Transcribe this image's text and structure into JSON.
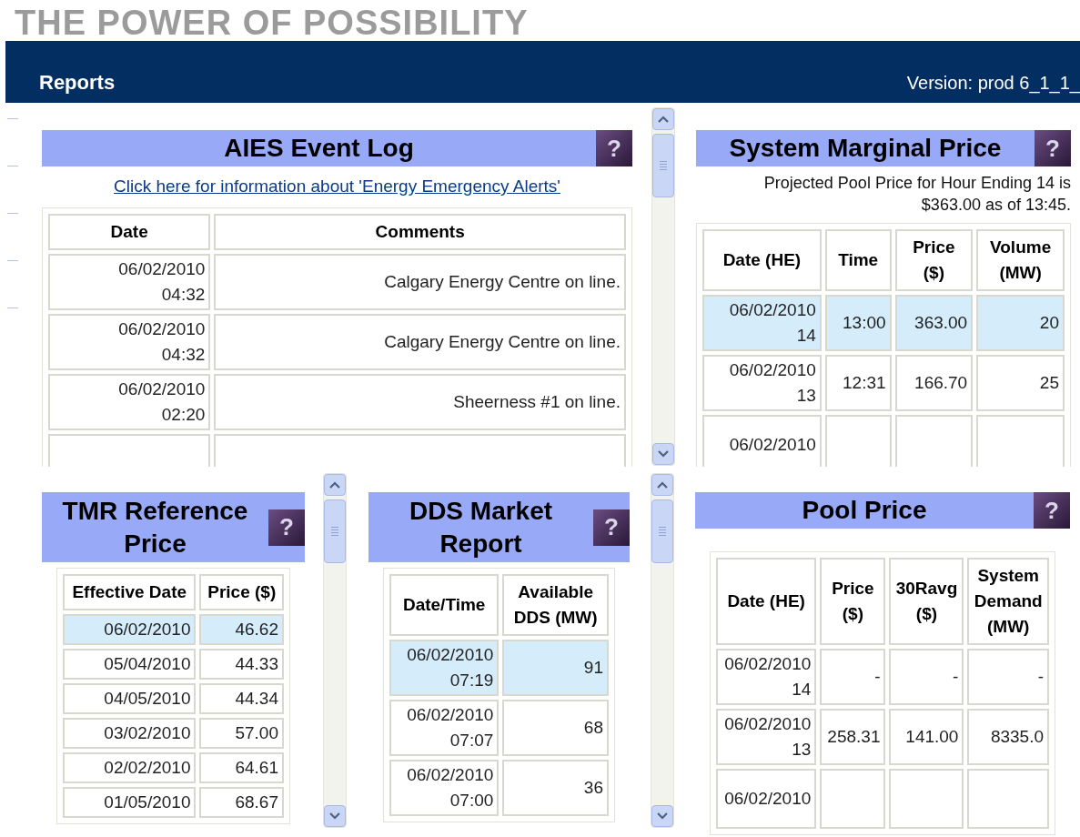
{
  "banner": {
    "slogan": "THE POWER OF POSSIBILITY"
  },
  "nav": {
    "title": "Reports",
    "version": "Version: prod 6_1_1_"
  },
  "panels": [
    {
      "title": "AIES Event Log",
      "help": "?",
      "link": "Click here for information about 'Energy Emergency Alerts'",
      "columns": [
        "Date",
        "Comments"
      ],
      "rows": [
        {
          "selected": false,
          "cells": [
            "06/02/2010\n04:32",
            "Calgary Energy Centre on line."
          ]
        },
        {
          "selected": false,
          "cells": [
            "06/02/2010\n04:32",
            "Calgary Energy Centre on line."
          ]
        },
        {
          "selected": false,
          "cells": [
            "06/02/2010\n02:20",
            "Sheerness #1 on line."
          ]
        },
        {
          "selected": false,
          "cells": [
            "",
            ""
          ]
        }
      ]
    },
    {
      "title": "System Marginal Price",
      "help": "?",
      "note": "Projected Pool Price for Hour Ending 14 is $363.00 as of 13:45.",
      "columns": [
        "Date (HE)",
        "Time",
        "Price\n($)",
        "Volume\n(MW)"
      ],
      "rows": [
        {
          "selected": true,
          "cells": [
            "06/02/2010\n14",
            "13:00",
            "363.00",
            "20"
          ]
        },
        {
          "selected": false,
          "cells": [
            "06/02/2010\n13",
            "12:31",
            "166.70",
            "25"
          ]
        },
        {
          "selected": false,
          "cells": [
            "06/02/2010",
            "",
            "",
            ""
          ]
        }
      ]
    },
    {
      "title": "TMR Reference Price",
      "help": "?",
      "columns": [
        "Effective Date",
        "Price ($)"
      ],
      "rows": [
        {
          "selected": true,
          "cells": [
            "06/02/2010",
            "46.62"
          ]
        },
        {
          "selected": false,
          "cells": [
            "05/04/2010",
            "44.33"
          ]
        },
        {
          "selected": false,
          "cells": [
            "04/05/2010",
            "44.34"
          ]
        },
        {
          "selected": false,
          "cells": [
            "03/02/2010",
            "57.00"
          ]
        },
        {
          "selected": false,
          "cells": [
            "02/02/2010",
            "64.61"
          ]
        },
        {
          "selected": false,
          "cells": [
            "01/05/2010",
            "68.67"
          ]
        }
      ]
    },
    {
      "title": "DDS Market Report",
      "help": "?",
      "columns": [
        "Date/Time",
        "Available\nDDS (MW)"
      ],
      "rows": [
        {
          "selected": true,
          "cells": [
            "06/02/2010\n07:19",
            "91"
          ]
        },
        {
          "selected": false,
          "cells": [
            "06/02/2010\n07:07",
            "68"
          ]
        },
        {
          "selected": false,
          "cells": [
            "06/02/2010\n07:00",
            "36"
          ]
        }
      ]
    },
    {
      "title": "Pool Price",
      "help": "?",
      "columns": [
        "Date (HE)",
        "Price\n($)",
        "30Ravg\n($)",
        "System\nDemand\n(MW)"
      ],
      "rows": [
        {
          "selected": false,
          "cells": [
            "06/02/2010\n14",
            "-",
            "-",
            "-"
          ]
        },
        {
          "selected": false,
          "cells": [
            "06/02/2010\n13",
            "258.31",
            "141.00",
            "8335.0"
          ]
        },
        {
          "selected": false,
          "cells": [
            "06/02/2010",
            "",
            "",
            ""
          ]
        }
      ]
    }
  ]
}
